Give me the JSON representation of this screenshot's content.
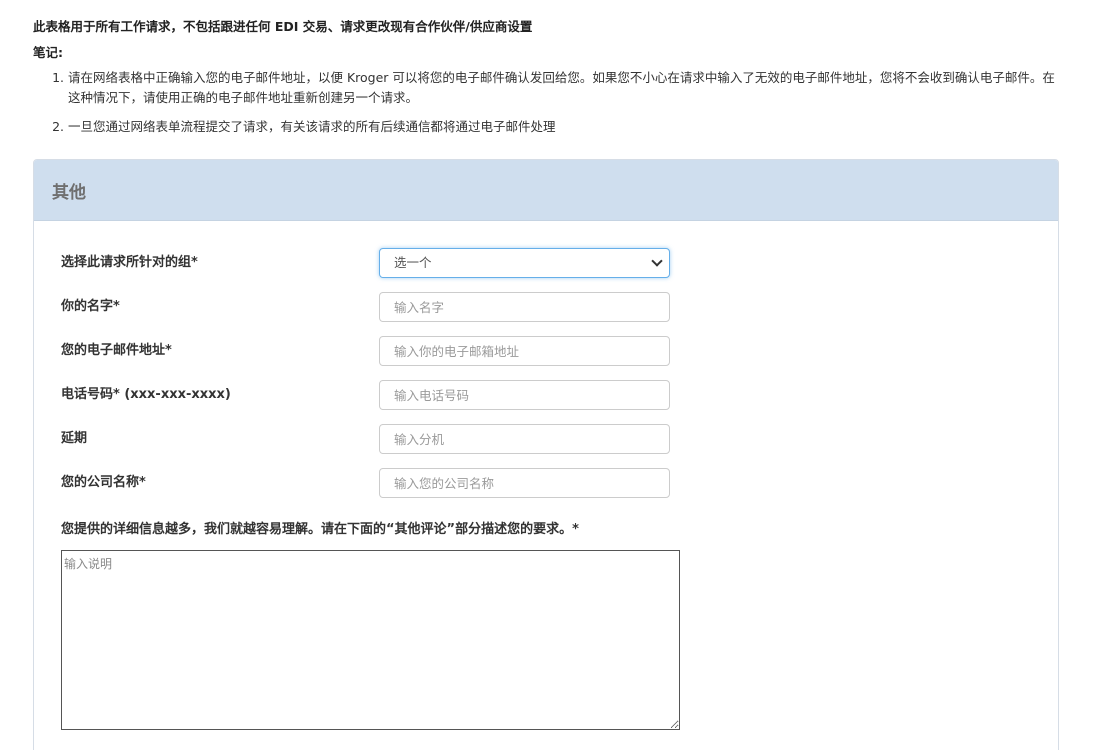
{
  "intro": {
    "scope_text": "此表格用于所有工作请求，不包括跟进任何 EDI 交易、请求更改现有合作伙伴/供应商设置",
    "notes_label": "笔记:",
    "notes": [
      "请在网络表格中正确输入您的电子邮件地址，以便 Kroger 可以将您的电子邮件确认发回给您。如果您不小心在请求中输入了无效的电子邮件地址，您将不会收到确认电子邮件。在这种情况下，请使用正确的电子邮件地址重新创建另一个请求。",
      "一旦您通过网络表单流程提交了请求，有关该请求的所有后续通信都将通过电子邮件处理"
    ]
  },
  "panel": {
    "title": "其他"
  },
  "form": {
    "group": {
      "label": "选择此请求所针对的组*",
      "selected": "选一个"
    },
    "name": {
      "label": "你的名字*",
      "placeholder": "输入名字"
    },
    "email": {
      "label": "您的电子邮件地址*",
      "placeholder": "输入你的电子邮箱地址"
    },
    "phone": {
      "label": "电话号码* (xxx-xxx-xxxx)",
      "placeholder": "输入电话号码"
    },
    "extension": {
      "label": "延期",
      "placeholder": "输入分机"
    },
    "company": {
      "label": "您的公司名称*",
      "placeholder": "输入您的公司名称"
    },
    "description": {
      "label": "您提供的详细信息越多，我们就越容易理解。请在下面的“其他评论”部分描述您的要求。*",
      "placeholder": "输入说明"
    }
  }
}
